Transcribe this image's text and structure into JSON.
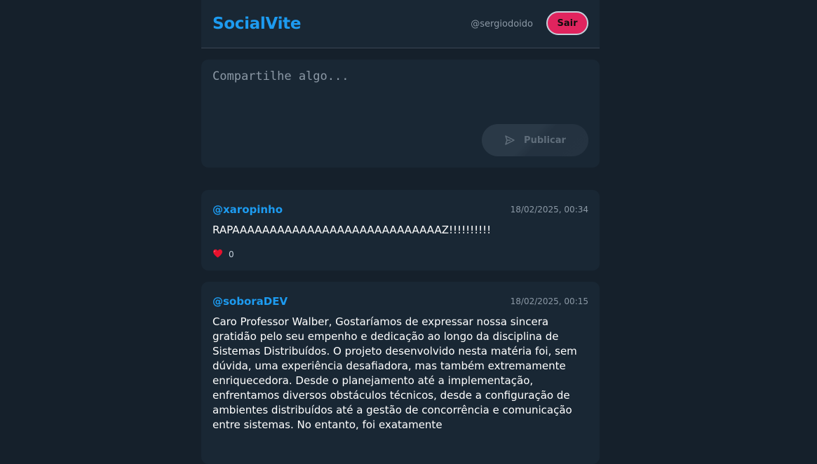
{
  "header": {
    "brand": "SocialVite",
    "username": "@sergiodoido",
    "logout_label": "Sair"
  },
  "composer": {
    "placeholder": "Compartilhe algo...",
    "publish_label": "Publicar"
  },
  "posts": [
    {
      "author": "@xaropinho",
      "date": "18/02/2025, 00:34",
      "body": "RAPAAAAAAAAAAAAAAAAAAAAAAAAAAAAZ!!!!!!!!!!",
      "likes": "0"
    },
    {
      "author": "@soboraDEV",
      "date": "18/02/2025, 00:15",
      "body": "Caro Professor Walber, Gostaríamos de expressar nossa sincera gratidão pelo seu empenho e dedicação ao longo da disciplina de Sistemas Distribuídos. O projeto desenvolvido nesta matéria foi, sem dúvida, uma experiência desafiadora, mas também extremamente enriquecedora. Desde o planejamento até a implementação, enfrentamos diversos obstáculos técnicos, desde a configuração de ambientes distribuídos até a gestão de concorrência e comunicação entre sistemas. No entanto, foi exatamente"
    }
  ],
  "colors": {
    "background": "#15202b",
    "card": "#192734",
    "accent": "#1d9bf0",
    "danger": "#e0245e"
  }
}
